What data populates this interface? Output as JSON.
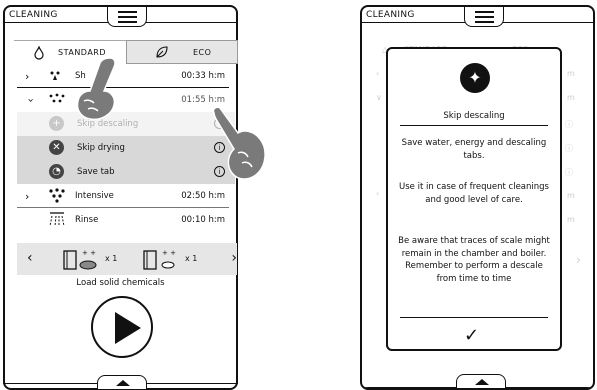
{
  "left_screen": {
    "header_title": "CLEANING",
    "mode_tabs": [
      {
        "label": "STANDARD",
        "icon": "flame-icon",
        "selected": true
      },
      {
        "label": "ECO",
        "icon": "leaf-icon",
        "selected": false
      }
    ],
    "programs": [
      {
        "name": "Sh",
        "time": "00:33 h:m",
        "icon": "spray-small-icon",
        "expanded": false
      },
      {
        "name": "",
        "time": "01:55 h:m",
        "icon": "spray-medium-icon",
        "expanded": true
      }
    ],
    "options": [
      {
        "label": "Skip descaling",
        "icon": "skip-descaling-icon",
        "dimmed": true
      },
      {
        "label": "Skip drying",
        "icon": "skip-drying-icon",
        "dimmed": false
      },
      {
        "label": "Save tab",
        "icon": "save-tab-icon",
        "dimmed": false
      }
    ],
    "programs_more": [
      {
        "name": "Intensive",
        "time": "02:50 h:m",
        "icon": "spray-large-icon"
      },
      {
        "name": "Rinse",
        "time": "00:10 h:m",
        "icon": "rinse-icon"
      }
    ],
    "chemicals": [
      {
        "count": "x 1",
        "icon": "tablet-icon"
      },
      {
        "count": "x 1",
        "icon": "tablet-small-icon"
      }
    ],
    "chemicals_label": "Load solid chemicals"
  },
  "right_screen": {
    "header_title": "CLEANING",
    "dialog": {
      "title": "Skip descaling",
      "paragraphs": [
        "Save water, energy and descaling tabs.",
        "Use it in case of frequent cleanings and good level of care.",
        "Be aware that traces of scale might remain in the chamber and boiler. Remember to perform a descale from time to time"
      ],
      "confirm_icon": "checkmark-icon"
    }
  },
  "colors": {
    "stroke": "#111111",
    "gray_highlight": "#d8d8d8",
    "hand": "#7a7a7a"
  }
}
